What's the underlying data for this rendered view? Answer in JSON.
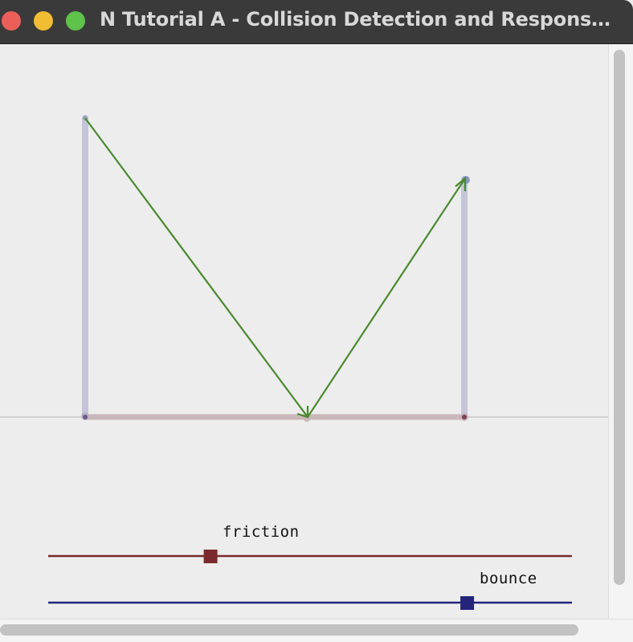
{
  "window": {
    "title": "N Tutorial A - Collision Detection and Response -..."
  },
  "sliders": [
    {
      "id": "friction",
      "label": "friction",
      "value": 0.31,
      "color": "#7a2a2c"
    },
    {
      "id": "bounce",
      "label": "bounce",
      "value": 0.8,
      "color": "#23247a"
    }
  ],
  "colors": {
    "velocity_arrow": "#4a8a2e",
    "normal_component": "#c3c4d9",
    "tangent_component": "#c9b5b8"
  }
}
